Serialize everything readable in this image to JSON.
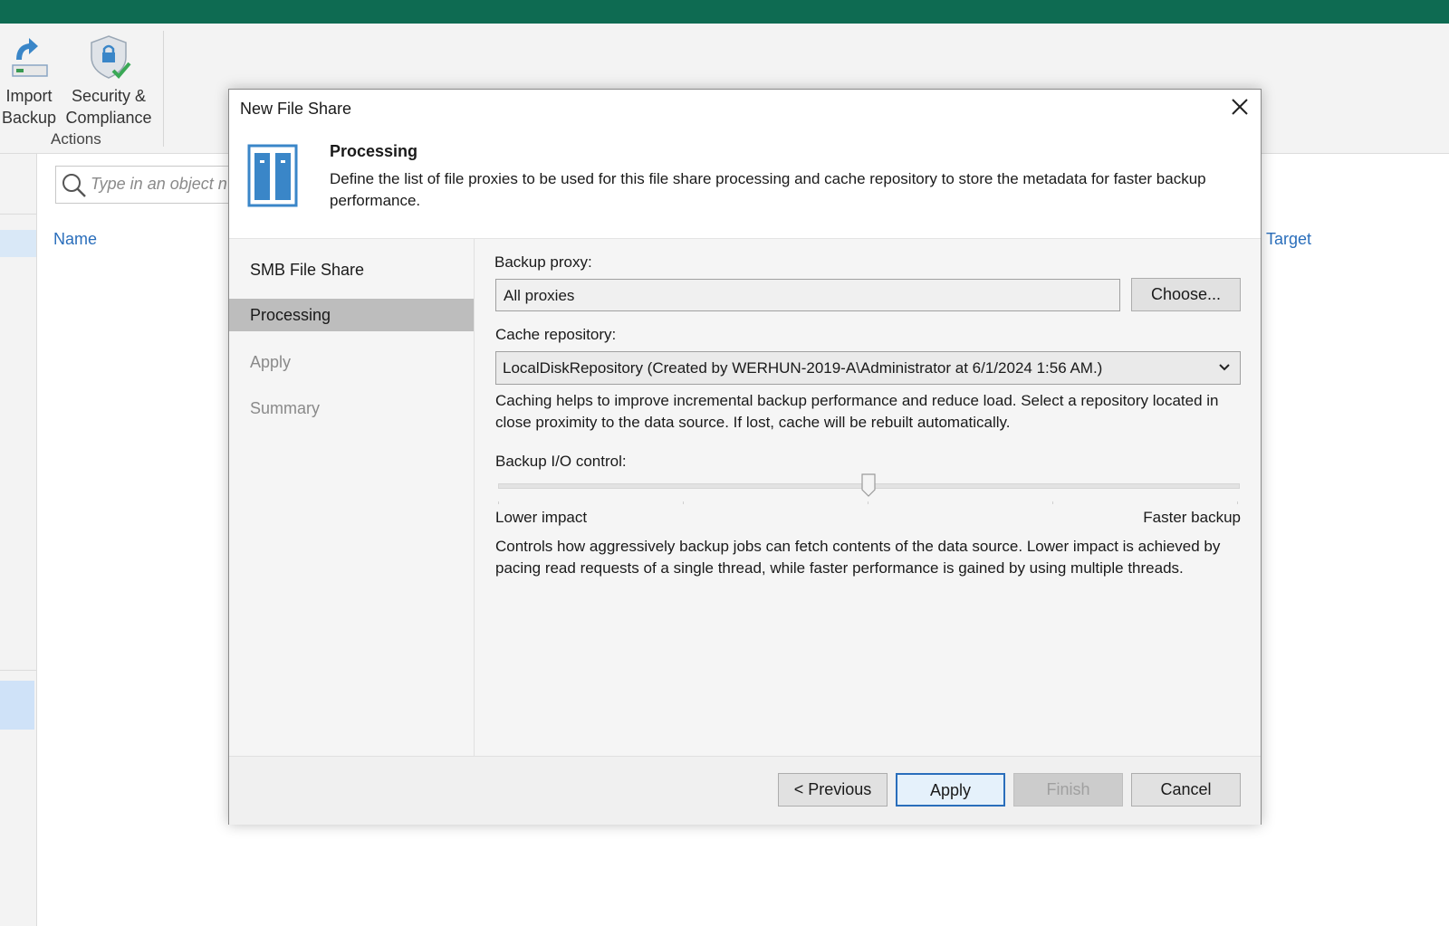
{
  "ribbon": {
    "import_backup": {
      "line1": "Import",
      "line2": "Backup",
      "icon": "import-arrow-icon"
    },
    "security_compliance": {
      "line1": "Security &",
      "line2": "Compliance",
      "icon": "shield-check-icon"
    },
    "group_label": "Actions"
  },
  "search": {
    "placeholder": "Type in an object n"
  },
  "list": {
    "column_name": "Name",
    "column_target": "Target"
  },
  "dialog": {
    "title": "New File Share",
    "close_icon": "close-icon",
    "step_title": "Processing",
    "step_description": "Define the list of file proxies to be used for this file share processing and cache repository to store the metadata for faster backup performance.",
    "nav": [
      {
        "label": "SMB File Share",
        "state": "normal"
      },
      {
        "label": "Processing",
        "state": "active"
      },
      {
        "label": "Apply",
        "state": "dim"
      },
      {
        "label": "Summary",
        "state": "dim"
      }
    ],
    "backup_proxy_label": "Backup proxy:",
    "backup_proxy_value": "All proxies",
    "choose_button": "Choose...",
    "cache_repo_label": "Cache repository:",
    "cache_repo_value": "LocalDiskRepository (Created by WERHUN-2019-A\\Administrator at 6/1/2024 1:56 AM.)",
    "cache_help": "Caching helps to improve incremental backup performance and reduce load. Select a repository located in close proximity to the data source. If lost, cache will be rebuilt automatically.",
    "io_control_label": "Backup I/O control:",
    "io_control_level": 0.5,
    "io_low_label": "Lower impact",
    "io_high_label": "Faster backup",
    "io_help": "Controls how aggressively backup jobs can fetch contents of the data source. Lower impact is achieved by pacing read requests of a single thread, while faster performance is gained by using multiple threads.",
    "buttons": {
      "previous": "< Previous",
      "apply": "Apply",
      "finish": "Finish",
      "cancel": "Cancel"
    }
  },
  "colors": {
    "titlebar": "#0e6b52",
    "link": "#2a6ebb",
    "accent_icon": "#3a86c8"
  }
}
